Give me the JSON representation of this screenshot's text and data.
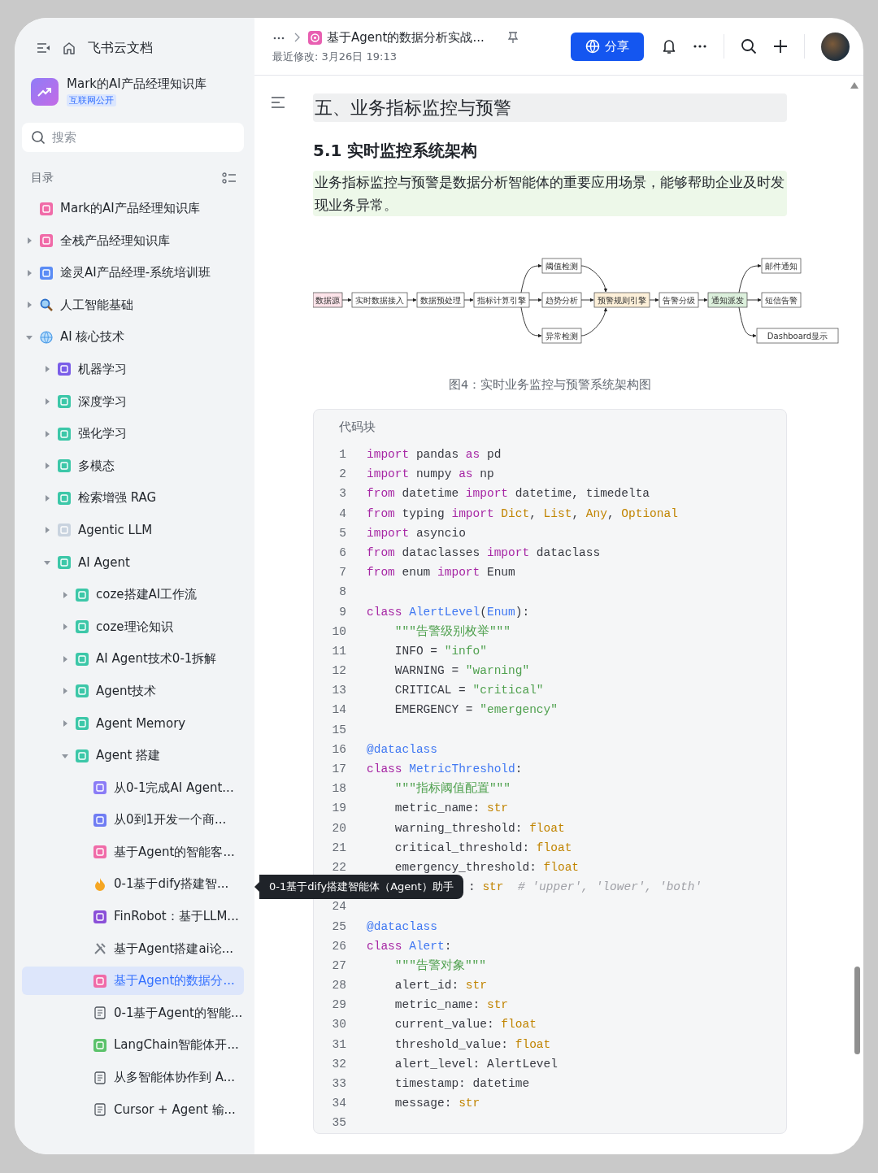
{
  "sidebar": {
    "app_title": "飞书云文档",
    "space": {
      "name": "Mark的AI产品经理知识库",
      "badge": "互联网公开"
    },
    "search": {
      "placeholder": "搜索"
    },
    "toc_label": "目录",
    "tree": [
      {
        "label": "Mark的AI产品经理知识库",
        "kind": "square",
        "color": "#f06ba8",
        "selected": false
      },
      {
        "label": "全栈产品经理知识库",
        "kind": "square",
        "color": "#f06ba8",
        "expanded": false,
        "selected": false
      },
      {
        "label": "途灵AI产品经理-系统培训班",
        "kind": "square",
        "color": "#5b8cf5",
        "expanded": false,
        "selected": false
      },
      {
        "label": "人工智能基础",
        "kind": "search",
        "expanded": false,
        "selected": false
      },
      {
        "label": "AI 核心技术",
        "kind": "globe",
        "expanded": true,
        "selected": false,
        "children": [
          {
            "label": "机器学习",
            "kind": "square",
            "color": "#7a5de8",
            "expanded": false,
            "selected": false
          },
          {
            "label": "深度学习",
            "kind": "square",
            "color": "#3cc7a8",
            "expanded": false,
            "selected": false
          },
          {
            "label": "强化学习",
            "kind": "square",
            "color": "#3cc7a8",
            "expanded": false,
            "selected": false
          },
          {
            "label": "多模态",
            "kind": "square",
            "color": "#3cc7a8",
            "expanded": false,
            "selected": false
          },
          {
            "label": "检索增强 RAG",
            "kind": "square",
            "color": "#3cc7a8",
            "expanded": false,
            "selected": false
          },
          {
            "label": "Agentic LLM",
            "kind": "square",
            "color": "#c9d3df",
            "expanded": false,
            "selected": false
          },
          {
            "label": "AI Agent",
            "kind": "square",
            "color": "#3cc7a8",
            "expanded": true,
            "selected": false,
            "children": [
              {
                "label": "coze搭建AI工作流",
                "kind": "square",
                "color": "#3cc7a8",
                "expanded": false,
                "selected": false
              },
              {
                "label": "coze理论知识",
                "kind": "square",
                "color": "#3cc7a8",
                "expanded": false,
                "selected": false
              },
              {
                "label": "AI Agent技术0-1拆解",
                "kind": "square",
                "color": "#3cc7a8",
                "expanded": false,
                "selected": false
              },
              {
                "label": "Agent技术",
                "kind": "square",
                "color": "#3cc7a8",
                "expanded": false,
                "selected": false
              },
              {
                "label": "Agent Memory",
                "kind": "square",
                "color": "#3cc7a8",
                "expanded": false,
                "selected": false
              },
              {
                "label": "Agent 搭建",
                "kind": "square",
                "color": "#3cc7a8",
                "expanded": true,
                "selected": false,
                "children": [
                  {
                    "label": "从0-1完成AI Agent...",
                    "kind": "square",
                    "color": "#8b7cf6",
                    "selected": false
                  },
                  {
                    "label": "从0到1开发一个商...",
                    "kind": "square",
                    "color": "#6f7cf3",
                    "selected": false
                  },
                  {
                    "label": "基于Agent的智能客...",
                    "kind": "square",
                    "color": "#f06ba8",
                    "selected": false
                  },
                  {
                    "label": "0-1基于dify搭建智...",
                    "kind": "flame",
                    "selected": false
                  },
                  {
                    "label": "FinRobot：基于LLM...",
                    "kind": "square",
                    "color": "#8a4fd8",
                    "selected": false
                  },
                  {
                    "label": "基于Agent搭建ai论...",
                    "kind": "tool",
                    "selected": false
                  },
                  {
                    "label": "基于Agent的数据分...",
                    "kind": "square",
                    "color": "#f06ba8",
                    "selected": true
                  },
                  {
                    "label": "0-1基于Agent的智能...",
                    "kind": "page",
                    "selected": false
                  },
                  {
                    "label": "LangChain智能体开...",
                    "kind": "square",
                    "color": "#5cc26b",
                    "selected": false
                  },
                  {
                    "label": "从多智能体协作到 A...",
                    "kind": "page",
                    "selected": false
                  },
                  {
                    "label": "Cursor + Agent 输...",
                    "kind": "page",
                    "selected": false
                  }
                ]
              }
            ]
          }
        ]
      }
    ]
  },
  "header": {
    "doc_title": "基于Agent的数据分析实战...",
    "last_modified": "最近修改: 3月26日 19:13",
    "share_button": "分享"
  },
  "content": {
    "heading": "五、业务指标监控与预警",
    "subheading": "5.1 实时监控系统架构",
    "callout": "业务指标监控与预警是数据分析智能体的重要应用场景，能够帮助企业及时发现业务异常。",
    "diagram": {
      "nodes": [
        {
          "label": "数据源",
          "color": "#fde4ea"
        },
        {
          "label": "实时数据接入",
          "color": "#ffffff"
        },
        {
          "label": "数据预处理",
          "color": "#ffffff"
        },
        {
          "label": "指标计算引擎",
          "color": "#ffffff"
        },
        {
          "label": "阈值检测",
          "color": "#ffffff"
        },
        {
          "label": "趋势分析",
          "color": "#ffffff"
        },
        {
          "label": "异常检测",
          "color": "#ffffff"
        },
        {
          "label": "预警规则引擎",
          "color": "#fdf0d9"
        },
        {
          "label": "告警分级",
          "color": "#ffffff"
        },
        {
          "label": "通知派发",
          "color": "#dcf0dc"
        },
        {
          "label": "邮件通知",
          "color": "#ffffff"
        },
        {
          "label": "短信告警",
          "color": "#ffffff"
        },
        {
          "label": "Dashboard显示",
          "color": "#ffffff"
        }
      ]
    },
    "caption": "图4：实时业务监控与预警系统架构图",
    "code_block": {
      "title": "代码块",
      "lines": [
        {
          "number": "1",
          "kind": "normal",
          "tokens": [
            {
              "kind": "kw",
              "text": "import"
            },
            {
              "kind": "plain",
              "text": " pandas "
            },
            {
              "kind": "kw",
              "text": "as"
            },
            {
              "kind": "plain",
              "text": " pd"
            }
          ]
        },
        {
          "number": "2",
          "kind": "normal",
          "tokens": [
            {
              "kind": "kw",
              "text": "import"
            },
            {
              "kind": "plain",
              "text": " numpy "
            },
            {
              "kind": "kw",
              "text": "as"
            },
            {
              "kind": "plain",
              "text": " np"
            }
          ]
        },
        {
          "number": "3",
          "kind": "normal",
          "tokens": [
            {
              "kind": "kw",
              "text": "from"
            },
            {
              "kind": "plain",
              "text": " datetime "
            },
            {
              "kind": "kw",
              "text": "import"
            },
            {
              "kind": "plain",
              "text": " datetime, timedelta"
            }
          ]
        },
        {
          "number": "4",
          "kind": "normal",
          "tokens": [
            {
              "kind": "kw",
              "text": "from"
            },
            {
              "kind": "plain",
              "text": " typing "
            },
            {
              "kind": "kw",
              "text": "import"
            },
            {
              "kind": "type",
              "text": " Dict"
            },
            {
              "kind": "plain",
              "text": ", "
            },
            {
              "kind": "type",
              "text": "List"
            },
            {
              "kind": "plain",
              "text": ", "
            },
            {
              "kind": "type",
              "text": "Any"
            },
            {
              "kind": "plain",
              "text": ", "
            },
            {
              "kind": "type",
              "text": "Optional"
            }
          ]
        },
        {
          "number": "5",
          "kind": "normal",
          "tokens": [
            {
              "kind": "kw",
              "text": "import"
            },
            {
              "kind": "plain",
              "text": " asyncio"
            }
          ]
        },
        {
          "number": "6",
          "kind": "normal",
          "tokens": [
            {
              "kind": "kw",
              "text": "from"
            },
            {
              "kind": "plain",
              "text": " dataclasses "
            },
            {
              "kind": "kw",
              "text": "import"
            },
            {
              "kind": "plain",
              "text": " dataclass"
            }
          ]
        },
        {
          "number": "7",
          "kind": "normal",
          "tokens": [
            {
              "kind": "kw",
              "text": "from"
            },
            {
              "kind": "plain",
              "text": " enum "
            },
            {
              "kind": "kw",
              "text": "import"
            },
            {
              "kind": "plain",
              "text": " Enum"
            }
          ]
        },
        {
          "number": "8",
          "kind": "normal"
        },
        {
          "number": "9",
          "kind": "normal",
          "tokens": [
            {
              "kind": "kw",
              "text": "class"
            },
            {
              "kind": "name",
              "text": " AlertLevel"
            },
            {
              "kind": "plain",
              "text": "("
            },
            {
              "kind": "name",
              "text": "Enum"
            },
            {
              "kind": "plain",
              "text": "):"
            }
          ]
        },
        {
          "number": "10",
          "kind": "normal",
          "tokens": [
            {
              "kind": "str",
              "text": "    \"\"\"告警级别枚举\"\"\""
            }
          ]
        },
        {
          "number": "11",
          "kind": "normal",
          "tokens": [
            {
              "kind": "plain",
              "text": "    INFO = "
            },
            {
              "kind": "str",
              "text": "\"info\""
            }
          ]
        },
        {
          "number": "12",
          "kind": "normal",
          "tokens": [
            {
              "kind": "plain",
              "text": "    WARNING = "
            },
            {
              "kind": "str",
              "text": "\"warning\""
            }
          ]
        },
        {
          "number": "13",
          "kind": "normal",
          "tokens": [
            {
              "kind": "plain",
              "text": "    CRITICAL = "
            },
            {
              "kind": "str",
              "text": "\"critical\""
            }
          ]
        },
        {
          "number": "14",
          "kind": "normal",
          "tokens": [
            {
              "kind": "plain",
              "text": "    EMERGENCY = "
            },
            {
              "kind": "str",
              "text": "\"emergency\""
            }
          ]
        },
        {
          "number": "15",
          "kind": "normal"
        },
        {
          "number": "16",
          "kind": "normal",
          "tokens": [
            {
              "kind": "name",
              "text": "@dataclass"
            }
          ]
        },
        {
          "number": "17",
          "kind": "normal",
          "tokens": [
            {
              "kind": "kw",
              "text": "class"
            },
            {
              "kind": "name",
              "text": " MetricThreshold"
            },
            {
              "kind": "plain",
              "text": ":"
            }
          ]
        },
        {
          "number": "18",
          "kind": "normal",
          "tokens": [
            {
              "kind": "str",
              "text": "    \"\"\"指标阈值配置\"\"\""
            }
          ]
        },
        {
          "number": "19",
          "kind": "normal",
          "tokens": [
            {
              "kind": "plain",
              "text": "    metric_name: "
            },
            {
              "kind": "type",
              "text": "str"
            }
          ]
        },
        {
          "number": "20",
          "kind": "normal",
          "tokens": [
            {
              "kind": "plain",
              "text": "    warning_threshold: "
            },
            {
              "kind": "type",
              "text": "float"
            }
          ]
        },
        {
          "number": "21",
          "kind": "normal",
          "tokens": [
            {
              "kind": "plain",
              "text": "    critical_threshold: "
            },
            {
              "kind": "type",
              "text": "float"
            }
          ]
        },
        {
          "number": "22",
          "kind": "normal",
          "tokens": [
            {
              "kind": "plain",
              "text": "    emergency_threshold: "
            },
            {
              "kind": "type",
              "text": "float"
            }
          ]
        },
        {
          "kind": "covered",
          "tokens": [
            {
              "kind": "plain",
              "text": ": "
            },
            {
              "kind": "type",
              "text": "str"
            },
            {
              "kind": "comment",
              "text": "  # 'upper', 'lower', 'both'"
            }
          ]
        },
        {
          "number": "24",
          "kind": "normal"
        },
        {
          "number": "25",
          "kind": "normal",
          "tokens": [
            {
              "kind": "name",
              "text": "@dataclass"
            }
          ]
        },
        {
          "number": "26",
          "kind": "normal",
          "tokens": [
            {
              "kind": "kw",
              "text": "class"
            },
            {
              "kind": "name",
              "text": " Alert"
            },
            {
              "kind": "plain",
              "text": ":"
            }
          ]
        },
        {
          "number": "27",
          "kind": "normal",
          "tokens": [
            {
              "kind": "str",
              "text": "    \"\"\"告警对象\"\"\""
            }
          ]
        },
        {
          "number": "28",
          "kind": "normal",
          "tokens": [
            {
              "kind": "plain",
              "text": "    alert_id: "
            },
            {
              "kind": "type",
              "text": "str"
            }
          ]
        },
        {
          "number": "29",
          "kind": "normal",
          "tokens": [
            {
              "kind": "plain",
              "text": "    metric_name: "
            },
            {
              "kind": "type",
              "text": "str"
            }
          ]
        },
        {
          "number": "30",
          "kind": "normal",
          "tokens": [
            {
              "kind": "plain",
              "text": "    current_value: "
            },
            {
              "kind": "type",
              "text": "float"
            }
          ]
        },
        {
          "number": "31",
          "kind": "normal",
          "tokens": [
            {
              "kind": "plain",
              "text": "    threshold_value: "
            },
            {
              "kind": "type",
              "text": "float"
            }
          ]
        },
        {
          "number": "32",
          "kind": "normal",
          "tokens": [
            {
              "kind": "plain",
              "text": "    alert_level: AlertLevel"
            }
          ]
        },
        {
          "number": "33",
          "kind": "normal",
          "tokens": [
            {
              "kind": "plain",
              "text": "    timestamp: datetime"
            }
          ]
        },
        {
          "number": "34",
          "kind": "normal",
          "tokens": [
            {
              "kind": "plain",
              "text": "    message: "
            },
            {
              "kind": "type",
              "text": "str"
            }
          ]
        },
        {
          "number": "35",
          "kind": "normal"
        }
      ]
    }
  },
  "tooltip": "0-1基于dify搭建智能体（Agent）助手"
}
